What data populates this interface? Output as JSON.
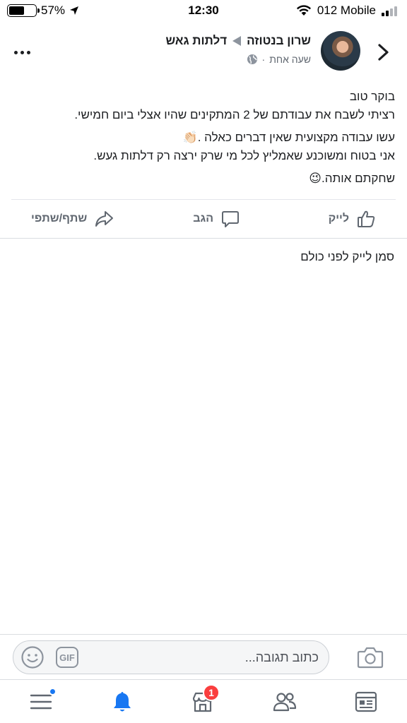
{
  "status_bar": {
    "battery_percent_label": "57%",
    "battery_level": 0.57,
    "time": "12:30",
    "carrier": "012 Mobile"
  },
  "post": {
    "author": "שרון בנטוזה",
    "page": "דלתות גאש",
    "time_ago": "שעה אחת",
    "meta_separator": "·",
    "lines": [
      "בוקר טוב",
      "רציתי לשבח את עבודתם של 2 המתקינים שהיו אצלי ביום חמישי.",
      "עשו עבודה מקצועית שאין דברים כאלה .",
      "אני בטוח ומשוכנע שאמליץ לכל מי שרק ירצה רק דלתות געש.",
      "שחקתם אותה."
    ],
    "emoji_clap": "👏🏻",
    "emoji_wink": "😉"
  },
  "actions": {
    "like": "לייק",
    "comment": "הגב",
    "share": "שתף/שתפי"
  },
  "first_like_text": "סמן לייק לפני כולם",
  "composer": {
    "placeholder": "כתוב תגובה...",
    "gif_label": "GIF"
  },
  "tab_bar": {
    "marketplace_badge": "1"
  },
  "colors": {
    "accent": "#1877f2",
    "badge": "#fa3e3e",
    "secondary_text": "#606770"
  }
}
